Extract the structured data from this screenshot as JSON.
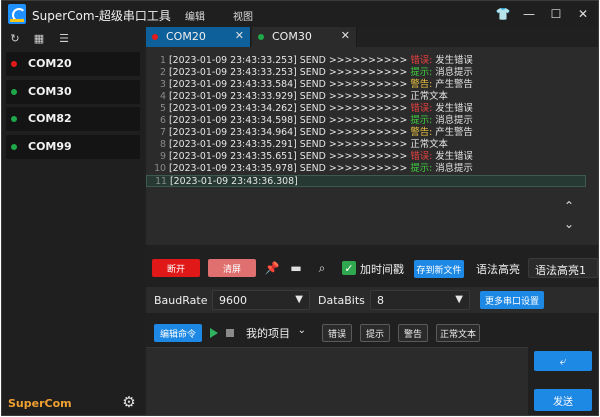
{
  "window": {
    "title": "SuperCom-超级串口工具",
    "menu": [
      "编辑",
      "视图"
    ],
    "controls": {
      "minimize": "—",
      "maximize": "☐",
      "close": "✕",
      "skin": "👕"
    }
  },
  "sidebar": {
    "tools": [
      "refresh-icon",
      "grid-icon",
      "sort-icon"
    ],
    "ports": [
      {
        "label": "COM20",
        "status_color": "#e51b1b"
      },
      {
        "label": "COM30",
        "status_color": "#1fa84a"
      },
      {
        "label": "COM82",
        "status_color": "#1fa84a"
      },
      {
        "label": "COM99",
        "status_color": "#1fa84a"
      }
    ],
    "brand": "SuperCom",
    "settings_icon": "gear-icon"
  },
  "tabs": [
    {
      "label": "COM20",
      "active": true,
      "status_color": "#e51b1b",
      "close": "✕"
    },
    {
      "label": "COM30",
      "active": false,
      "status_color": "#1fa84a",
      "close": "✕"
    }
  ],
  "log": {
    "lines": [
      {
        "n": "1",
        "ts": "[2023-01-09 23:43:33.253] SEND >>>>>>>>>> ",
        "level": "错误: ",
        "msg": "发生错误",
        "cls": "lv-red"
      },
      {
        "n": "2",
        "ts": "[2023-01-09 23:43:33.253] SEND >>>>>>>>>> ",
        "level": "提示: ",
        "msg": "消息提示",
        "cls": "lv-green"
      },
      {
        "n": "3",
        "ts": "[2023-01-09 23:43:33.584] SEND >>>>>>>>>> ",
        "level": "警告: ",
        "msg": "产生警告",
        "cls": "lv-yellow"
      },
      {
        "n": "4",
        "ts": "[2023-01-09 23:43:33.929] SEND >>>>>>>>>> ",
        "level": "",
        "msg": "正常文本",
        "cls": "lv-white"
      },
      {
        "n": "5",
        "ts": "[2023-01-09 23:43:34.262] SEND >>>>>>>>>> ",
        "level": "错误: ",
        "msg": "发生错误",
        "cls": "lv-red"
      },
      {
        "n": "6",
        "ts": "[2023-01-09 23:43:34.598] SEND >>>>>>>>>> ",
        "level": "提示: ",
        "msg": "消息提示",
        "cls": "lv-green"
      },
      {
        "n": "7",
        "ts": "[2023-01-09 23:43:34.964] SEND >>>>>>>>>> ",
        "level": "警告: ",
        "msg": "产生警告",
        "cls": "lv-yellow"
      },
      {
        "n": "8",
        "ts": "[2023-01-09 23:43:35.291] SEND >>>>>>>>>> ",
        "level": "",
        "msg": "正常文本",
        "cls": "lv-white"
      },
      {
        "n": "9",
        "ts": "[2023-01-09 23:43:35.651] SEND >>>>>>>>>> ",
        "level": "错误: ",
        "msg": "发生错误",
        "cls": "lv-red"
      },
      {
        "n": "10",
        "ts": "[2023-01-09 23:43:35.978] SEND >>>>>>>>>> ",
        "level": "提示: ",
        "msg": "消息提示",
        "cls": "lv-green"
      },
      {
        "n": "11",
        "ts": "[2023-01-09 23:43:36.308]",
        "level": "",
        "msg": "",
        "cls": "lv-white"
      }
    ],
    "scroll_up": "⌃",
    "scroll_down": "⌄"
  },
  "actions": {
    "disconnect": "断开",
    "clear": "清屏",
    "timestamp_checked": true,
    "timestamp_label": "加时间戳",
    "save_new_file": "存到新文件",
    "highlight_label": "语法高亮",
    "highlight_value": "语法高亮1"
  },
  "serial": {
    "baudrate_label": "BaudRate",
    "baudrate_value": "9600",
    "databits_label": "DataBits",
    "databits_value": "8",
    "more_settings": "更多串口设置"
  },
  "commands": {
    "edit": "编辑命令",
    "project": "我的项目",
    "quick": [
      "错误",
      "提示",
      "警告",
      "正常文本"
    ]
  },
  "send": {
    "label": "发送",
    "newline_icon": "wrap-icon"
  }
}
